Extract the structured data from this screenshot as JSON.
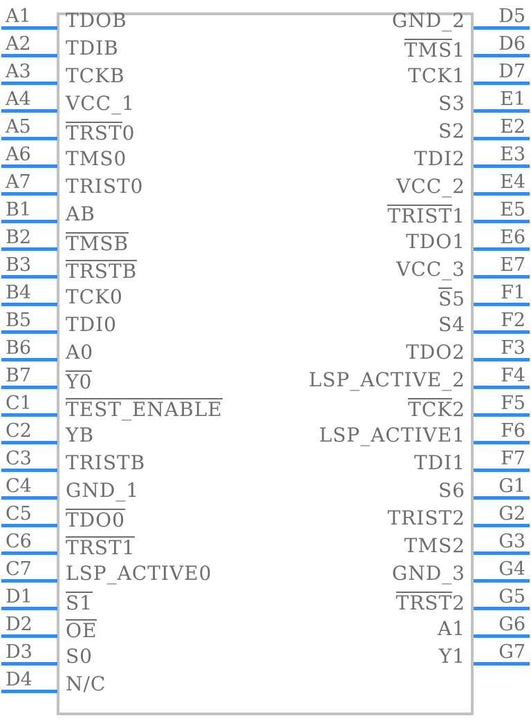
{
  "diagram": {
    "kind": "ic-pinout-symbol",
    "body_color": "#c2c2c2",
    "lead_color": "#3b8ae8",
    "text_color": "#6e6e6e",
    "background": "#ffffff",
    "left_pin_count": 25,
    "right_pin_count": 24
  },
  "left_pins": [
    {
      "number": "A1",
      "name": "TDOB",
      "overline": ""
    },
    {
      "number": "A2",
      "name": "TDIB",
      "overline": ""
    },
    {
      "number": "A3",
      "name": "TCKB",
      "overline": ""
    },
    {
      "number": "A4",
      "name": "VCC_1",
      "overline": ""
    },
    {
      "number": "A5",
      "name": "TRST0",
      "overline": "TRST"
    },
    {
      "number": "A6",
      "name": "TMS0",
      "overline": ""
    },
    {
      "number": "A7",
      "name": "TRIST0",
      "overline": ""
    },
    {
      "number": "B1",
      "name": "AB",
      "overline": ""
    },
    {
      "number": "B2",
      "name": "TMSB",
      "overline": "TMSB"
    },
    {
      "number": "B3",
      "name": "TRSTB",
      "overline": "TRSTB"
    },
    {
      "number": "B4",
      "name": "TCK0",
      "overline": ""
    },
    {
      "number": "B5",
      "name": "TDI0",
      "overline": ""
    },
    {
      "number": "B6",
      "name": "A0",
      "overline": ""
    },
    {
      "number": "B7",
      "name": "Y0",
      "overline": "Y0"
    },
    {
      "number": "C1",
      "name": "TEST_ENABLE",
      "overline": "TEST_ENABLE"
    },
    {
      "number": "C2",
      "name": "YB",
      "overline": ""
    },
    {
      "number": "C3",
      "name": "TRISTB",
      "overline": ""
    },
    {
      "number": "C4",
      "name": "GND_1",
      "overline": ""
    },
    {
      "number": "C5",
      "name": "TDO0",
      "overline": "TDO0"
    },
    {
      "number": "C6",
      "name": "TRST1",
      "overline": "TRST1"
    },
    {
      "number": "C7",
      "name": "LSP_ACTIVE0",
      "overline": ""
    },
    {
      "number": "D1",
      "name": "S1",
      "overline": "S1"
    },
    {
      "number": "D2",
      "name": "OE",
      "overline": "OE"
    },
    {
      "number": "D3",
      "name": "S0",
      "overline": ""
    },
    {
      "number": "D4",
      "name": "N/C",
      "overline": ""
    }
  ],
  "right_pins": [
    {
      "number": "D5",
      "name": "GND_2",
      "overline": ""
    },
    {
      "number": "D6",
      "name": "TMS1",
      "overline": "TMS"
    },
    {
      "number": "D7",
      "name": "TCK1",
      "overline": ""
    },
    {
      "number": "E1",
      "name": "S3",
      "overline": ""
    },
    {
      "number": "E2",
      "name": "S2",
      "overline": ""
    },
    {
      "number": "E3",
      "name": "TDI2",
      "overline": ""
    },
    {
      "number": "E4",
      "name": "VCC_2",
      "overline": ""
    },
    {
      "number": "E5",
      "name": "TRIST1",
      "overline": "TRIST"
    },
    {
      "number": "E6",
      "name": "TDO1",
      "overline": ""
    },
    {
      "number": "E7",
      "name": "VCC_3",
      "overline": ""
    },
    {
      "number": "F1",
      "name": "S5",
      "overline": "S"
    },
    {
      "number": "F2",
      "name": "S4",
      "overline": ""
    },
    {
      "number": "F3",
      "name": "TDO2",
      "overline": ""
    },
    {
      "number": "F4",
      "name": "LSP_ACTIVE_2",
      "overline": ""
    },
    {
      "number": "F5",
      "name": "TCK2",
      "overline": "TCK"
    },
    {
      "number": "F6",
      "name": "LSP_ACTIVE1",
      "overline": ""
    },
    {
      "number": "F7",
      "name": "TDI1",
      "overline": ""
    },
    {
      "number": "G1",
      "name": "S6",
      "overline": ""
    },
    {
      "number": "G2",
      "name": "TRIST2",
      "overline": ""
    },
    {
      "number": "G3",
      "name": "TMS2",
      "overline": ""
    },
    {
      "number": "G4",
      "name": "GND_3",
      "overline": ""
    },
    {
      "number": "G5",
      "name": "TRST2",
      "overline": "TRST"
    },
    {
      "number": "G6",
      "name": "A1",
      "overline": ""
    },
    {
      "number": "G7",
      "name": "Y1",
      "overline": ""
    }
  ]
}
